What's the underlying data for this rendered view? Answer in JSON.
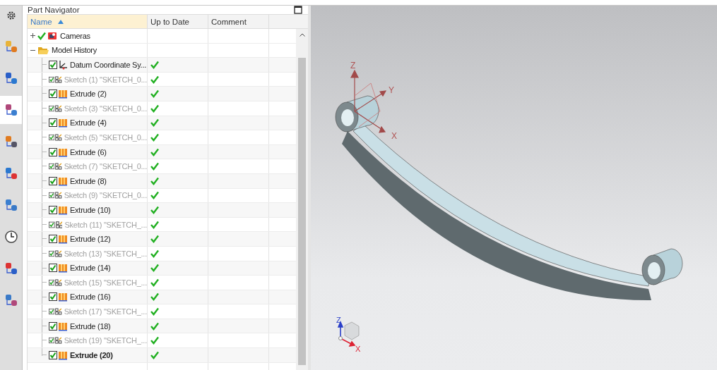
{
  "sidebar": {
    "tabs": [
      {
        "selected": false
      },
      {
        "selected": false
      },
      {
        "selected": true
      },
      {
        "selected": false
      },
      {
        "selected": false
      },
      {
        "selected": false
      },
      {
        "selected": false
      },
      {
        "selected": false
      },
      {
        "selected": false
      }
    ]
  },
  "panel": {
    "title": "Part Navigator"
  },
  "columns": [
    {
      "label": "Name",
      "sorted": true
    },
    {
      "label": "Up to Date",
      "sorted": false
    },
    {
      "label": "Comment",
      "sorted": false
    }
  ],
  "tree": [
    {
      "label": "Cameras",
      "kind": "cameras",
      "expanded": false,
      "checked": true
    },
    {
      "label": "Model History",
      "kind": "folder",
      "expanded": true,
      "children": [
        {
          "label": "Datum Coordinate Sy...",
          "kind": "datum",
          "checked": true,
          "up_to_date": true,
          "dimmed": false,
          "current": false
        },
        {
          "label": "Sketch (1) \"SKETCH_0...",
          "kind": "sketch",
          "checked": true,
          "up_to_date": true,
          "dimmed": true,
          "current": false
        },
        {
          "label": "Extrude (2)",
          "kind": "extrude",
          "checked": true,
          "up_to_date": true,
          "dimmed": false,
          "current": false
        },
        {
          "label": "Sketch (3) \"SKETCH_0...",
          "kind": "sketch",
          "checked": true,
          "up_to_date": true,
          "dimmed": true,
          "current": false
        },
        {
          "label": "Extrude (4)",
          "kind": "extrude",
          "checked": true,
          "up_to_date": true,
          "dimmed": false,
          "current": false
        },
        {
          "label": "Sketch (5) \"SKETCH_0...",
          "kind": "sketch",
          "checked": true,
          "up_to_date": true,
          "dimmed": true,
          "current": false
        },
        {
          "label": "Extrude (6)",
          "kind": "extrude",
          "checked": true,
          "up_to_date": true,
          "dimmed": false,
          "current": false
        },
        {
          "label": "Sketch (7) \"SKETCH_0...",
          "kind": "sketch",
          "checked": true,
          "up_to_date": true,
          "dimmed": true,
          "current": false
        },
        {
          "label": "Extrude (8)",
          "kind": "extrude",
          "checked": true,
          "up_to_date": true,
          "dimmed": false,
          "current": false
        },
        {
          "label": "Sketch (9) \"SKETCH_0...",
          "kind": "sketch",
          "checked": true,
          "up_to_date": true,
          "dimmed": true,
          "current": false
        },
        {
          "label": "Extrude (10)",
          "kind": "extrude",
          "checked": true,
          "up_to_date": true,
          "dimmed": false,
          "current": false
        },
        {
          "label": "Sketch (11) \"SKETCH_...",
          "kind": "sketch",
          "checked": true,
          "up_to_date": true,
          "dimmed": true,
          "current": false
        },
        {
          "label": "Extrude (12)",
          "kind": "extrude",
          "checked": true,
          "up_to_date": true,
          "dimmed": false,
          "current": false
        },
        {
          "label": "Sketch (13) \"SKETCH_...",
          "kind": "sketch",
          "checked": true,
          "up_to_date": true,
          "dimmed": true,
          "current": false
        },
        {
          "label": "Extrude (14)",
          "kind": "extrude",
          "checked": true,
          "up_to_date": true,
          "dimmed": false,
          "current": false
        },
        {
          "label": "Sketch (15) \"SKETCH_...",
          "kind": "sketch",
          "checked": true,
          "up_to_date": true,
          "dimmed": true,
          "current": false
        },
        {
          "label": "Extrude (16)",
          "kind": "extrude",
          "checked": true,
          "up_to_date": true,
          "dimmed": false,
          "current": false
        },
        {
          "label": "Sketch (17) \"SKETCH_...",
          "kind": "sketch",
          "checked": true,
          "up_to_date": true,
          "dimmed": true,
          "current": false
        },
        {
          "label": "Extrude (18)",
          "kind": "extrude",
          "checked": true,
          "up_to_date": true,
          "dimmed": false,
          "current": false
        },
        {
          "label": "Sketch (19) \"SKETCH_...",
          "kind": "sketch",
          "checked": true,
          "up_to_date": true,
          "dimmed": true,
          "current": false
        },
        {
          "label": "Extrude (20)",
          "kind": "extrude",
          "checked": true,
          "up_to_date": true,
          "dimmed": false,
          "current": true
        }
      ]
    }
  ],
  "viewport": {
    "axis_labels": [
      "Z",
      "Y",
      "X"
    ],
    "triad_labels": [
      "Z",
      "X"
    ]
  }
}
